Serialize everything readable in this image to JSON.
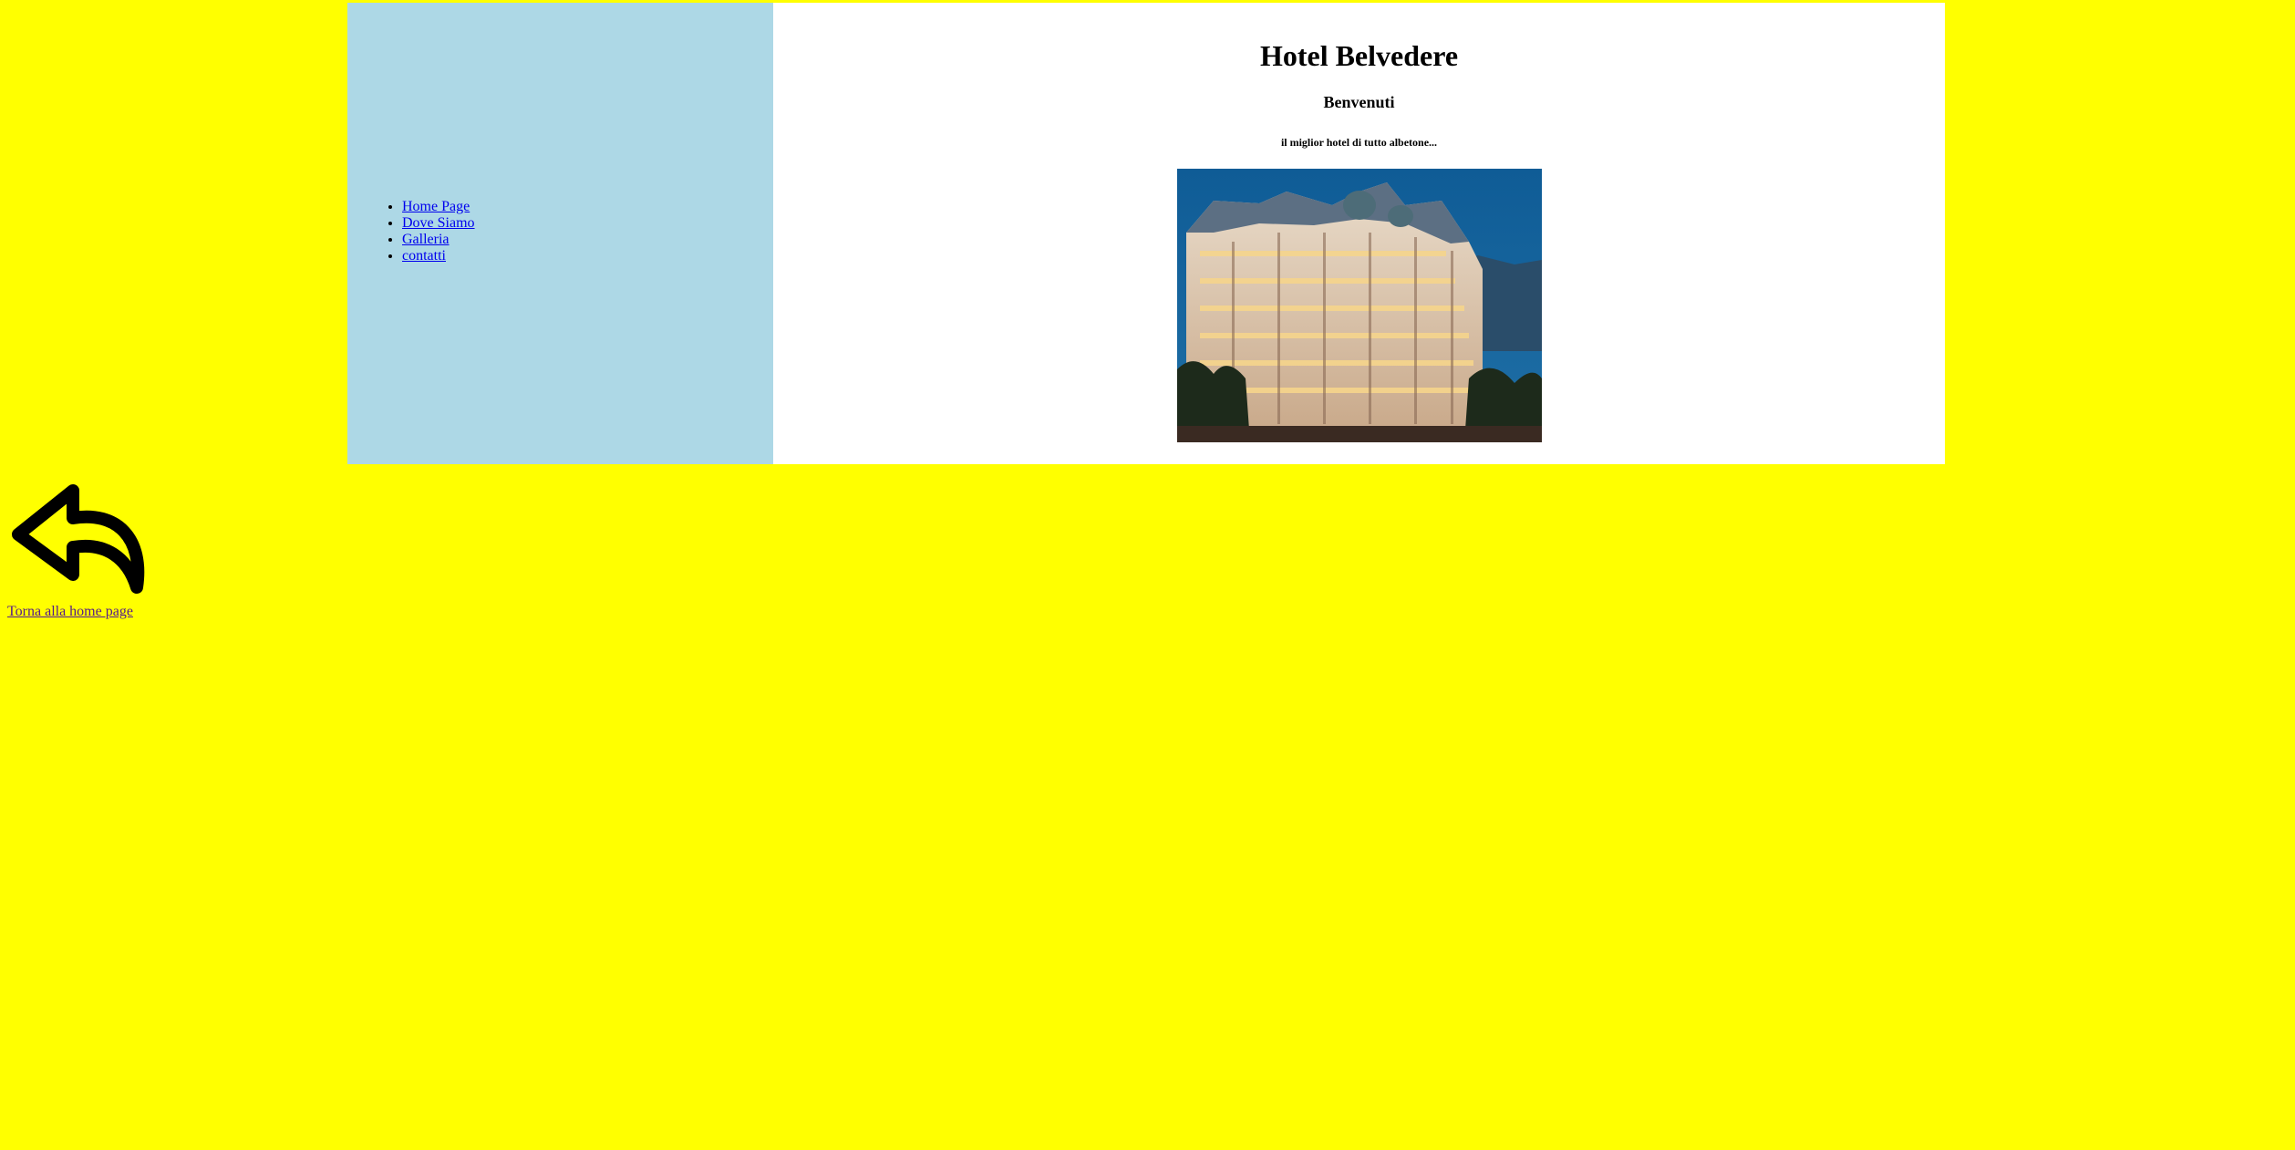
{
  "sidebar": {
    "items": [
      {
        "label": "Home Page"
      },
      {
        "label": "Dove Siamo"
      },
      {
        "label": "Galleria"
      },
      {
        "label": "contatti"
      }
    ]
  },
  "main": {
    "title": "Hotel Belvedere",
    "subtitle": "Benvenuti",
    "tagline": "il miglior hotel di tutto albetone...",
    "image_icon": "hotel-building-photo"
  },
  "back": {
    "icon": "reply-arrow-icon",
    "label": "Torna alla home page"
  },
  "colors": {
    "page_background": "#ffff00",
    "sidebar_background": "#add8e6",
    "content_background": "#ffffff",
    "link": "#0000ee",
    "visited_link": "#551a8b"
  }
}
